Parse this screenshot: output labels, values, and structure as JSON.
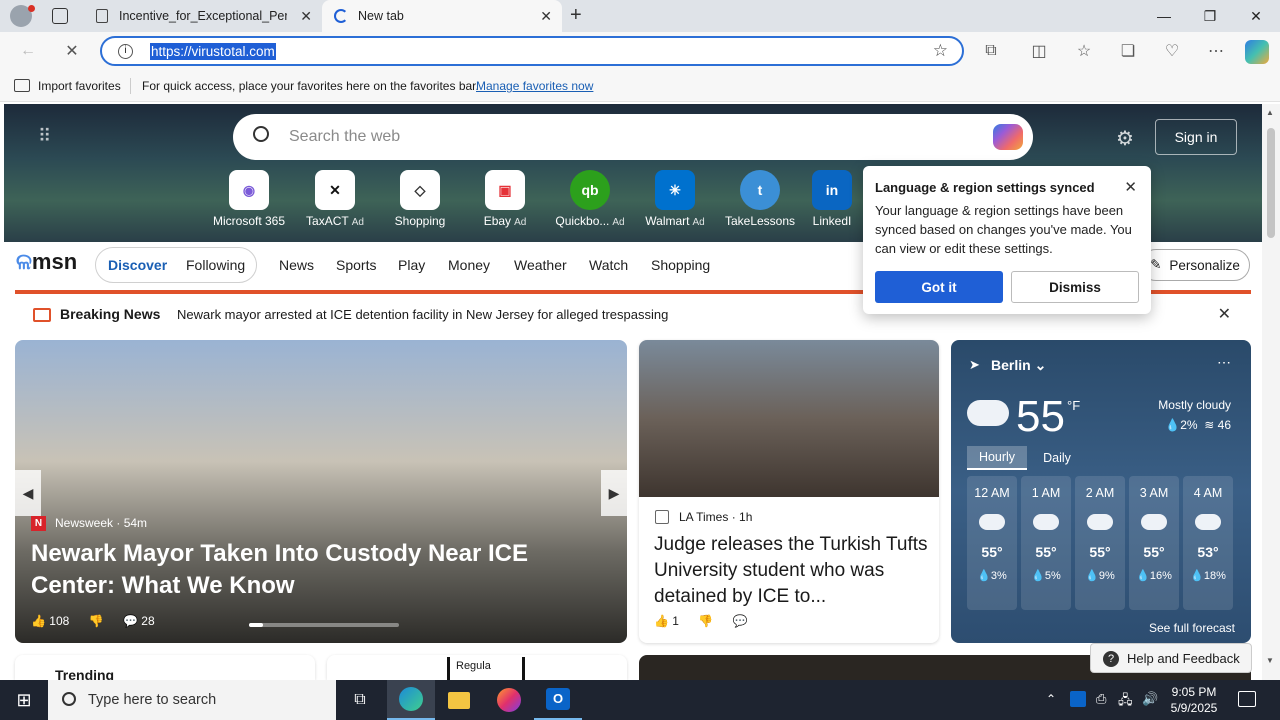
{
  "browser": {
    "tabs": [
      {
        "label": "Incentive_for_Exceptional_Perfor"
      },
      {
        "label": "New tab"
      }
    ],
    "address": {
      "url": "https://virustotal.com"
    },
    "favorites_bar": {
      "import_label": "Import favorites",
      "hint": "For quick access, place your favorites here on the favorites bar.",
      "manage_link": "Manage favorites now"
    }
  },
  "newtab": {
    "search_placeholder": "Search the web",
    "signin_label": "Sign in",
    "quick_links": [
      {
        "label": "Microsoft 365",
        "ad": ""
      },
      {
        "label": "TaxACT",
        "ad": "Ad"
      },
      {
        "label": "Shopping",
        "ad": ""
      },
      {
        "label": "Ebay",
        "ad": "Ad"
      },
      {
        "label": "Quickbo...",
        "ad": "Ad"
      },
      {
        "label": "Walmart",
        "ad": "Ad"
      },
      {
        "label": "TakeLessons",
        "ad": ""
      },
      {
        "label": "LinkedI",
        "ad": ""
      }
    ],
    "msn": {
      "logo": "msn",
      "discover": "Discover",
      "following": "Following",
      "nav": [
        "News",
        "Sports",
        "Play",
        "Money",
        "Weather",
        "Watch",
        "Shopping"
      ],
      "personalize": "Personalize"
    },
    "breaking": {
      "label": "Breaking News",
      "text": "Newark mayor arrested at ICE detention facility in New Jersey for alleged trespassing"
    },
    "card_main": {
      "source": "Newsweek",
      "age": "54m",
      "headline": "Newark Mayor Taken Into Custody Near ICE Center: What We Know",
      "likes": "108",
      "comments": "28"
    },
    "card_side": {
      "source": "LA Times",
      "age": "1h",
      "headline": "Judge releases the Turkish Tufts University student who was detained by ICE to...",
      "likes": "1"
    },
    "weather": {
      "city": "Berlin",
      "temp": "55",
      "unit": "°F",
      "condition": "Mostly cloudy",
      "precip": "2%",
      "wind": "46",
      "tab_hourly": "Hourly",
      "tab_daily": "Daily",
      "hours": [
        {
          "time": "12 AM",
          "temp": "55°",
          "precip": "3%"
        },
        {
          "time": "1 AM",
          "temp": "55°",
          "precip": "5%"
        },
        {
          "time": "2 AM",
          "temp": "55°",
          "precip": "9%"
        },
        {
          "time": "3 AM",
          "temp": "55°",
          "precip": "16%"
        },
        {
          "time": "4 AM",
          "temp": "53°",
          "precip": "18%"
        }
      ],
      "full_forecast": "See full forecast"
    },
    "popup": {
      "title": "Language & region settings synced",
      "body": "Your language & region settings have been synced based on changes you've made. You can view or edit these settings.",
      "got_it": "Got it",
      "dismiss": "Dismiss"
    },
    "feedback": "Help and Feedback",
    "trending": "Trending",
    "regula": "Regula"
  },
  "taskbar": {
    "search_placeholder": "Type here to search",
    "time": "9:05 PM",
    "date": "5/9/2025"
  }
}
